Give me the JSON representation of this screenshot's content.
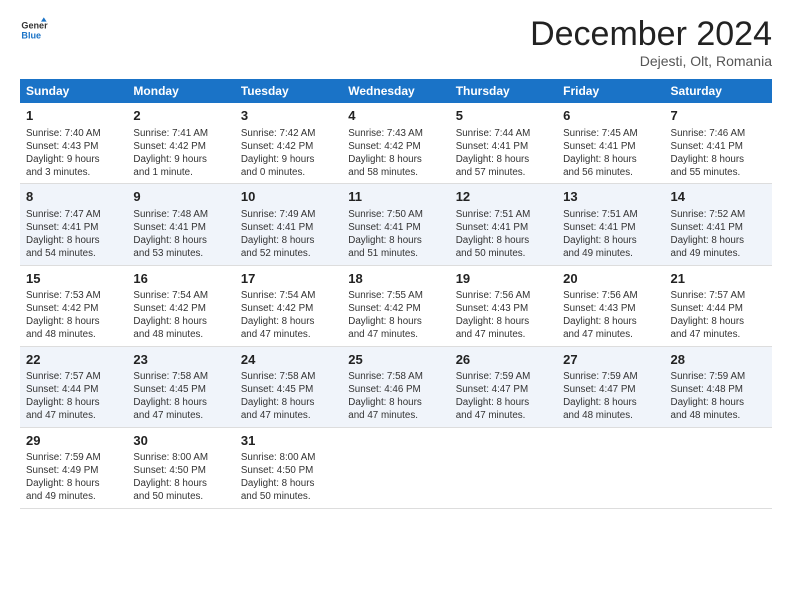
{
  "header": {
    "logo_line1": "General",
    "logo_line2": "Blue",
    "month": "December 2024",
    "location": "Dejesti, Olt, Romania"
  },
  "weekdays": [
    "Sunday",
    "Monday",
    "Tuesday",
    "Wednesday",
    "Thursday",
    "Friday",
    "Saturday"
  ],
  "weeks": [
    [
      {
        "day": "1",
        "info": "Sunrise: 7:40 AM\nSunset: 4:43 PM\nDaylight: 9 hours\nand 3 minutes."
      },
      {
        "day": "2",
        "info": "Sunrise: 7:41 AM\nSunset: 4:42 PM\nDaylight: 9 hours\nand 1 minute."
      },
      {
        "day": "3",
        "info": "Sunrise: 7:42 AM\nSunset: 4:42 PM\nDaylight: 9 hours\nand 0 minutes."
      },
      {
        "day": "4",
        "info": "Sunrise: 7:43 AM\nSunset: 4:42 PM\nDaylight: 8 hours\nand 58 minutes."
      },
      {
        "day": "5",
        "info": "Sunrise: 7:44 AM\nSunset: 4:41 PM\nDaylight: 8 hours\nand 57 minutes."
      },
      {
        "day": "6",
        "info": "Sunrise: 7:45 AM\nSunset: 4:41 PM\nDaylight: 8 hours\nand 56 minutes."
      },
      {
        "day": "7",
        "info": "Sunrise: 7:46 AM\nSunset: 4:41 PM\nDaylight: 8 hours\nand 55 minutes."
      }
    ],
    [
      {
        "day": "8",
        "info": "Sunrise: 7:47 AM\nSunset: 4:41 PM\nDaylight: 8 hours\nand 54 minutes."
      },
      {
        "day": "9",
        "info": "Sunrise: 7:48 AM\nSunset: 4:41 PM\nDaylight: 8 hours\nand 53 minutes."
      },
      {
        "day": "10",
        "info": "Sunrise: 7:49 AM\nSunset: 4:41 PM\nDaylight: 8 hours\nand 52 minutes."
      },
      {
        "day": "11",
        "info": "Sunrise: 7:50 AM\nSunset: 4:41 PM\nDaylight: 8 hours\nand 51 minutes."
      },
      {
        "day": "12",
        "info": "Sunrise: 7:51 AM\nSunset: 4:41 PM\nDaylight: 8 hours\nand 50 minutes."
      },
      {
        "day": "13",
        "info": "Sunrise: 7:51 AM\nSunset: 4:41 PM\nDaylight: 8 hours\nand 49 minutes."
      },
      {
        "day": "14",
        "info": "Sunrise: 7:52 AM\nSunset: 4:41 PM\nDaylight: 8 hours\nand 49 minutes."
      }
    ],
    [
      {
        "day": "15",
        "info": "Sunrise: 7:53 AM\nSunset: 4:42 PM\nDaylight: 8 hours\nand 48 minutes."
      },
      {
        "day": "16",
        "info": "Sunrise: 7:54 AM\nSunset: 4:42 PM\nDaylight: 8 hours\nand 48 minutes."
      },
      {
        "day": "17",
        "info": "Sunrise: 7:54 AM\nSunset: 4:42 PM\nDaylight: 8 hours\nand 47 minutes."
      },
      {
        "day": "18",
        "info": "Sunrise: 7:55 AM\nSunset: 4:42 PM\nDaylight: 8 hours\nand 47 minutes."
      },
      {
        "day": "19",
        "info": "Sunrise: 7:56 AM\nSunset: 4:43 PM\nDaylight: 8 hours\nand 47 minutes."
      },
      {
        "day": "20",
        "info": "Sunrise: 7:56 AM\nSunset: 4:43 PM\nDaylight: 8 hours\nand 47 minutes."
      },
      {
        "day": "21",
        "info": "Sunrise: 7:57 AM\nSunset: 4:44 PM\nDaylight: 8 hours\nand 47 minutes."
      }
    ],
    [
      {
        "day": "22",
        "info": "Sunrise: 7:57 AM\nSunset: 4:44 PM\nDaylight: 8 hours\nand 47 minutes."
      },
      {
        "day": "23",
        "info": "Sunrise: 7:58 AM\nSunset: 4:45 PM\nDaylight: 8 hours\nand 47 minutes."
      },
      {
        "day": "24",
        "info": "Sunrise: 7:58 AM\nSunset: 4:45 PM\nDaylight: 8 hours\nand 47 minutes."
      },
      {
        "day": "25",
        "info": "Sunrise: 7:58 AM\nSunset: 4:46 PM\nDaylight: 8 hours\nand 47 minutes."
      },
      {
        "day": "26",
        "info": "Sunrise: 7:59 AM\nSunset: 4:47 PM\nDaylight: 8 hours\nand 47 minutes."
      },
      {
        "day": "27",
        "info": "Sunrise: 7:59 AM\nSunset: 4:47 PM\nDaylight: 8 hours\nand 48 minutes."
      },
      {
        "day": "28",
        "info": "Sunrise: 7:59 AM\nSunset: 4:48 PM\nDaylight: 8 hours\nand 48 minutes."
      }
    ],
    [
      {
        "day": "29",
        "info": "Sunrise: 7:59 AM\nSunset: 4:49 PM\nDaylight: 8 hours\nand 49 minutes."
      },
      {
        "day": "30",
        "info": "Sunrise: 8:00 AM\nSunset: 4:50 PM\nDaylight: 8 hours\nand 50 minutes."
      },
      {
        "day": "31",
        "info": "Sunrise: 8:00 AM\nSunset: 4:50 PM\nDaylight: 8 hours\nand 50 minutes."
      },
      {
        "day": "",
        "info": ""
      },
      {
        "day": "",
        "info": ""
      },
      {
        "day": "",
        "info": ""
      },
      {
        "day": "",
        "info": ""
      }
    ]
  ]
}
